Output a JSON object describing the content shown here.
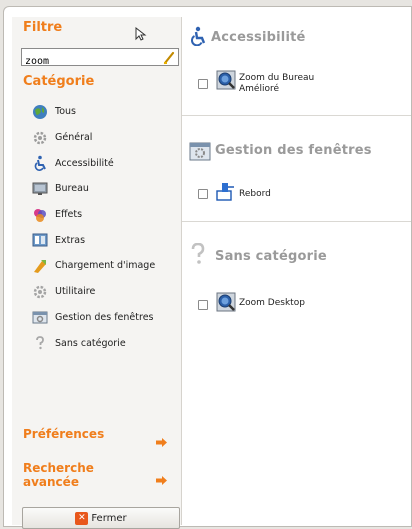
{
  "sidebar": {
    "filter_title": "Filtre",
    "search": {
      "value": "zoom"
    },
    "category_title": "Catégorie",
    "categories": [
      {
        "label": "Tous",
        "icon": "globe-icon"
      },
      {
        "label": "Général",
        "icon": "gear-icon"
      },
      {
        "label": "Accessibilité",
        "icon": "accessibility-icon"
      },
      {
        "label": "Bureau",
        "icon": "desktop-icon"
      },
      {
        "label": "Effets",
        "icon": "effects-icon"
      },
      {
        "label": "Extras",
        "icon": "extras-icon"
      },
      {
        "label": "Chargement d'image",
        "icon": "image-loading-icon"
      },
      {
        "label": "Utilitaire",
        "icon": "utility-gear-icon"
      },
      {
        "label": "Gestion des fenêtres",
        "icon": "window-management-icon"
      },
      {
        "label": "Sans catégorie",
        "icon": "question-icon"
      }
    ],
    "preferences_label": "Préférences",
    "advanced_search_label_line1": "Recherche",
    "advanced_search_label_line2": "avancée",
    "close_button_label": "Fermer"
  },
  "content": {
    "sections": [
      {
        "title": "Accessibilité",
        "icon": "accessibility-icon",
        "plugins": [
          {
            "line1": "Zoom du Bureau",
            "line2": "Amélioré",
            "checked": false,
            "icon": "zoom-icon"
          }
        ]
      },
      {
        "title": "Gestion des fenêtres",
        "icon": "window-management-icon",
        "plugins": [
          {
            "line1": "Rebord",
            "line2": "",
            "checked": false,
            "icon": "rebord-icon"
          }
        ]
      },
      {
        "title": "Sans catégorie",
        "icon": "question-icon",
        "plugins": [
          {
            "line1": "Zoom Desktop",
            "line2": "",
            "checked": false,
            "icon": "zoom-icon"
          }
        ]
      }
    ]
  },
  "colors": {
    "accent": "#f07e1c",
    "section_title": "#9a9a9a",
    "close_icon": "#e8571b"
  }
}
